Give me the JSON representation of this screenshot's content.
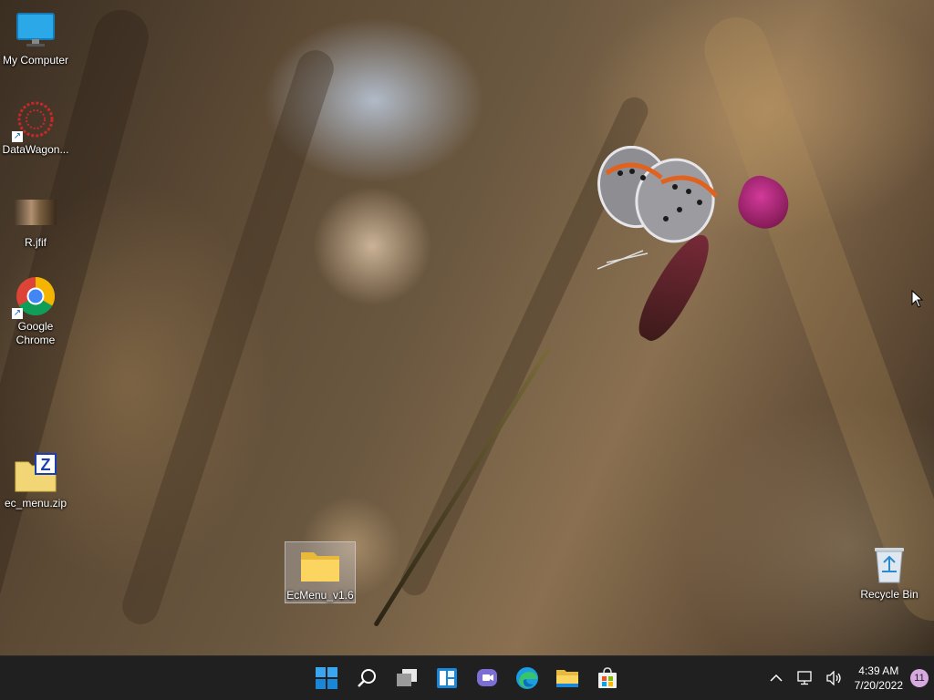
{
  "desktop": {
    "icons": [
      {
        "label": "My Computer",
        "icon": "monitor-icon"
      },
      {
        "label": "DataWagon...",
        "icon": "datawagon-icon",
        "shortcut": true
      },
      {
        "label": "R.jfif",
        "icon": "image-thumbnail-icon"
      },
      {
        "label": "Google Chrome",
        "icon": "chrome-icon",
        "shortcut": true
      },
      {
        "label": "ec_menu.zip",
        "icon": "zip-archive-icon"
      },
      {
        "label": "EcMenu_v1.6",
        "icon": "folder-icon",
        "selected": true
      },
      {
        "label": "Recycle Bin",
        "icon": "recycle-bin-icon"
      }
    ],
    "shortcut_arrow": "↗"
  },
  "taskbar": {
    "apps": [
      {
        "name": "start",
        "icon": "windows-logo-icon"
      },
      {
        "name": "search",
        "icon": "search-icon"
      },
      {
        "name": "task-view",
        "icon": "task-view-icon"
      },
      {
        "name": "widgets",
        "icon": "widgets-icon"
      },
      {
        "name": "chat",
        "icon": "teams-chat-icon"
      },
      {
        "name": "edge",
        "icon": "edge-icon"
      },
      {
        "name": "file-explorer",
        "icon": "file-explorer-icon"
      },
      {
        "name": "store",
        "icon": "store-icon"
      }
    ],
    "tray": {
      "chevron": "^",
      "time": "4:39 AM",
      "date": "7/20/2022",
      "notification_count": "11"
    }
  },
  "colors": {
    "taskbar_bg": "#202020",
    "accent_blue": "#0078d4"
  }
}
